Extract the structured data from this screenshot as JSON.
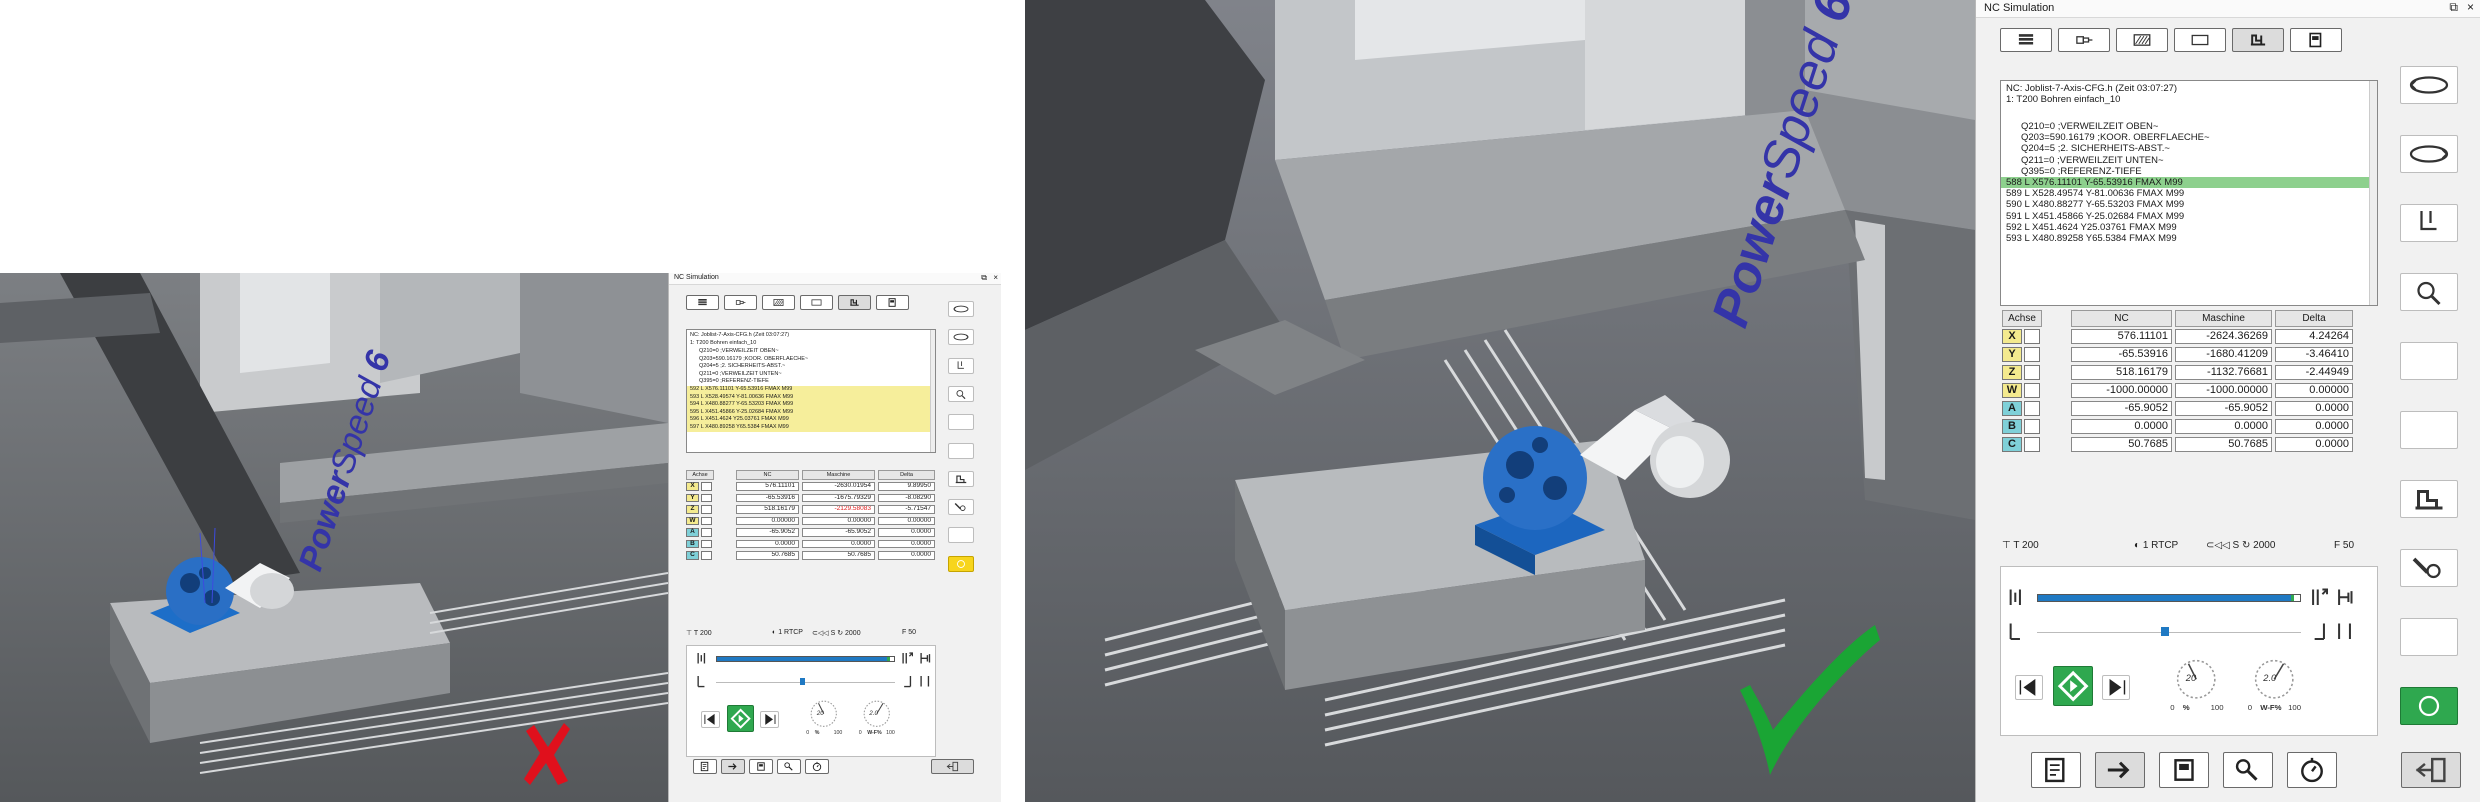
{
  "panel": {
    "title": "NC Simulation",
    "toolbar_icons": [
      "cube-icon",
      "spindle-icon",
      "hatch-icon",
      "rectangle-icon",
      "machine-icon",
      "tool-magazine-icon"
    ],
    "program_header": [
      "NC: Joblist-7-Axis-CFG.h (Zeit 03:07:27)",
      "1: T200 Bohren einfach_10"
    ],
    "program_lines": [
      "Q210=0 ;VERWEILZEIT OBEN~",
      "Q203=590.16179 ;KOOR. OBERFLAECHE~",
      "Q204=5 ;2. SICHERHEITS-ABST.~",
      "Q211=0 ;VERWEILZEIT UNTEN~",
      "Q395=0 ;REFERENZ-TIEFE",
      "588 L X576.11101 Y-65.53916 FMAX M99",
      "589 L X528.49574 Y-81.00636 FMAX M99",
      "590 L X480.88277 Y-65.53203 FMAX M99",
      "591 L X451.45866 Y-25.02684 FMAX M99",
      "592 L X451.4624 Y25.03761 FMAX M99",
      "593 L X480.89258 Y65.5384 FMAX M99"
    ],
    "small_program_lines": [
      "Q210=0 ;VERWEILZEIT OBEN~",
      "Q203=590.16179 ;KOOR. OBERFLAECHE~",
      "Q204=5 ;2. SICHERHEITS-ABST.~",
      "Q211=0 ;VERWEILZEIT UNTEN~",
      "Q395=0 ;REFERENZ-TIEFE",
      "592 L X576.11101 Y-65.53916 FMAX M99",
      "593 L X528.49574 Y-81.00636 FMAX M99",
      "594 L X480.88277 Y-65.53203 FMAX M99",
      "595 L X451.45866 Y-25.02684 FMAX M99",
      "596 L X451.4624 Y25.03761 FMAX M99",
      "597 L X480.89258 Y65.5384 FMAX M99"
    ],
    "axis_headers": [
      "Achse",
      "NC",
      "Maschine",
      "Delta"
    ],
    "axes": [
      {
        "name": "X",
        "color": "yellow",
        "nc": "576.11101",
        "machine": "-2624.36269",
        "delta": "4.24264"
      },
      {
        "name": "Y",
        "color": "yellow",
        "nc": "-65.53916",
        "machine": "-1680.41209",
        "delta": "-3.46410"
      },
      {
        "name": "Z",
        "color": "yellow",
        "nc": "518.16179",
        "machine": "-1132.76681",
        "delta": "-2.44949"
      },
      {
        "name": "W",
        "color": "yellow",
        "nc": "-1000.00000",
        "machine": "-1000.00000",
        "delta": "0.00000"
      },
      {
        "name": "A",
        "color": "teal",
        "nc": "-65.9052",
        "machine": "-65.9052",
        "delta": "0.0000"
      },
      {
        "name": "B",
        "color": "teal",
        "nc": "0.0000",
        "machine": "0.0000",
        "delta": "0.0000"
      },
      {
        "name": "C",
        "color": "teal",
        "nc": "50.7685",
        "machine": "50.7685",
        "delta": "0.0000"
      }
    ],
    "small_axes": [
      {
        "name": "X",
        "color": "yellow",
        "nc": "576.11101",
        "machine": "-2630.01954",
        "delta": "9.89950"
      },
      {
        "name": "Y",
        "color": "yellow",
        "nc": "-65.53916",
        "machine": "-1675.79329",
        "delta": "-8.08290"
      },
      {
        "name": "Z",
        "color": "yellow",
        "nc": "518.16179",
        "machine": "-2129.58083",
        "delta": "-5.71547"
      },
      {
        "name": "W",
        "color": "yellow",
        "nc": "0.00000",
        "machine": "0.00000",
        "delta": "0.00000"
      },
      {
        "name": "A",
        "color": "teal",
        "nc": "-65.9052",
        "machine": "-65.9052",
        "delta": "0.0000"
      },
      {
        "name": "B",
        "color": "teal",
        "nc": "0.0000",
        "machine": "0.0000",
        "delta": "0.0000"
      },
      {
        "name": "C",
        "color": "teal",
        "nc": "50.7685",
        "machine": "50.7685",
        "delta": "0.0000"
      }
    ],
    "status": {
      "tool": "T 200",
      "rtcp": "1 RTCP",
      "spindle": "S",
      "speed": "2000",
      "feed": "F 50"
    },
    "dial_labels": {
      "d1_min": "0",
      "d1_max": "100",
      "d1_unit": "%",
      "d2_min": "0",
      "d2_max": "100",
      "d2_unit": "W-F%"
    },
    "dial_values": {
      "d1": "20",
      "d2": "2.0"
    },
    "feed_slider_fraction": 0.98,
    "step_slider_fraction": 0.47
  },
  "scene": {
    "brand": "PowerSpeed 6",
    "brand_power": "Power",
    "brand_speed": "Speed",
    "brand_num": "6"
  },
  "colors": {
    "highlight_green": "#8dd08d",
    "highlight_yellow": "#f6ee9b",
    "axis_yellow": "#f4ea8e",
    "axis_teal": "#7fd0d8",
    "brand_blue": "#3434a8",
    "check_green": "#1aa534",
    "cross_red": "#e0101c"
  }
}
